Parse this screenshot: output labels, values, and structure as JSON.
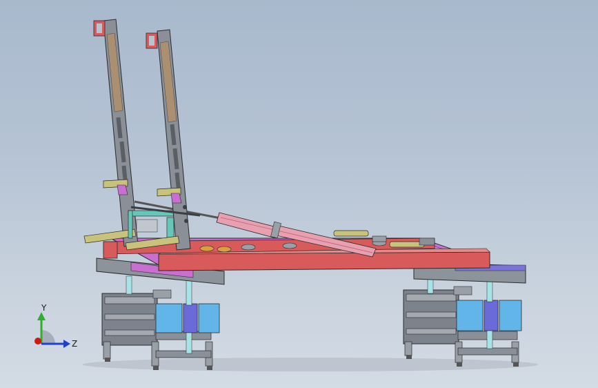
{
  "view": {
    "background_top": "#a9b9cd",
    "background_bottom": "#d3dbe4"
  },
  "triad": {
    "y_label": "Y",
    "z_label": "Z",
    "y_color": "#2fae2f",
    "z_color": "#1f3fd0",
    "x_color": "#d01818"
  },
  "colors": {
    "steel_grey": "#8a8f98",
    "frame_red": "#d85a5a",
    "frame_magenta": "#c86fcf",
    "light_blue": "#62b5e8",
    "purple_blue": "#6a6ad8",
    "pink_cylinder": "#e8a0b0",
    "olive_pad": "#c9c27a",
    "cyan_rod": "#a7e3e6"
  }
}
